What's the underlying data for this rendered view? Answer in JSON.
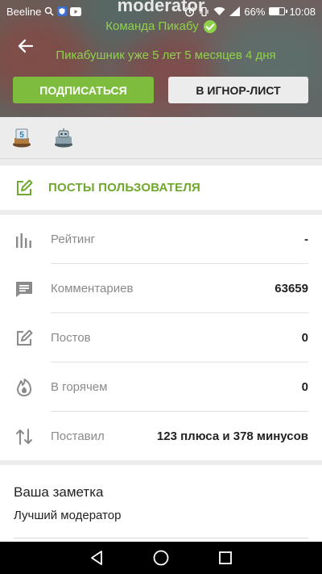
{
  "status_bar": {
    "carrier": "Beeline",
    "battery": "66%",
    "battery_level": 0.66,
    "time": "10:08"
  },
  "profile": {
    "username": "moderator",
    "team": "Команда Пикабу",
    "membership": "Пикабушник уже 5 лет 5 месяцев 4 дня",
    "subscribe_label": "ПОДПИСАТЬСЯ",
    "ignore_label": "В ИГНОР-ЛИСТ"
  },
  "posts_link": {
    "label": "ПОСТЫ ПОЛЬЗОВАТЕЛЯ"
  },
  "stats": [
    {
      "icon": "bar-chart-icon",
      "label": "Рейтинг",
      "value": "-"
    },
    {
      "icon": "comment-icon",
      "label": "Комментариев",
      "value": "63659"
    },
    {
      "icon": "edit-icon",
      "label": "Постов",
      "value": "0"
    },
    {
      "icon": "flame-icon",
      "label": "В горячем",
      "value": "0"
    },
    {
      "icon": "swap-vertical-icon",
      "label": "Поставил",
      "value": "123 плюса и 378 минусов"
    }
  ],
  "note": {
    "title": "Ваша заметка",
    "text": "Лучший модератор"
  },
  "colors": {
    "accent_green": "#7ebc3e",
    "link_green": "#6fa82f",
    "header_green_text": "#8ed24b"
  }
}
